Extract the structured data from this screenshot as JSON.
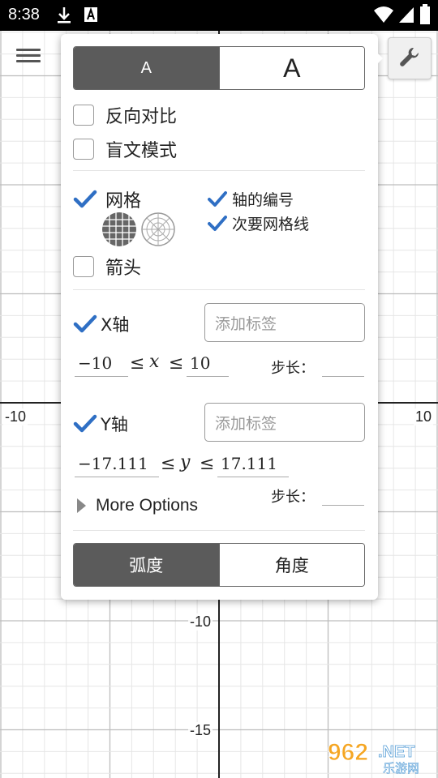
{
  "status_bar": {
    "time": "8:38",
    "icons": [
      "download-icon",
      "a-notification-icon",
      "wifi-icon",
      "signal-icon",
      "battery-icon"
    ]
  },
  "graph": {
    "axis_labels": {
      "x_neg": "-10",
      "x_pos": "10",
      "y_neg_10": "-10",
      "y_neg_15": "-15"
    }
  },
  "toolbar": {
    "menu_icon": "hamburger-menu-icon",
    "settings_icon": "wrench-icon"
  },
  "settings": {
    "font_size": {
      "small": "A",
      "large": "A",
      "selected": "small"
    },
    "reverse_contrast": {
      "label": "反向对比",
      "checked": false
    },
    "braille_mode": {
      "label": "盲文模式",
      "checked": false
    },
    "grid": {
      "label": "网格",
      "checked": true,
      "types": [
        "cartesian-grid-icon",
        "polar-grid-icon"
      ],
      "selected_type": "cartesian-grid-icon"
    },
    "axis_numbers": {
      "label": "轴的编号",
      "checked": true
    },
    "minor_gridlines": {
      "label": "次要网格线",
      "checked": true
    },
    "arrows": {
      "label": "箭头",
      "checked": false
    },
    "x_axis": {
      "label": "X轴",
      "checked": true,
      "placeholder": "添加标签",
      "min": "−10",
      "max": "10",
      "var": "x",
      "op": "≤",
      "step_label": "步长："
    },
    "y_axis": {
      "label": "Y轴",
      "checked": true,
      "placeholder": "添加标签",
      "min": "−17.111",
      "max": "17.111",
      "var": "y",
      "op": "≤",
      "step_label": "步长："
    },
    "more_options": "More Options",
    "angle_mode": {
      "radians": "弧度",
      "degrees": "角度",
      "selected": "radians"
    }
  },
  "watermark": {
    "text": "962",
    "suffix": ".NET",
    "sub": "乐游网"
  },
  "colors": {
    "check": "#2f6fc4",
    "selected_segment": "#5b5b5b",
    "axis": "#222222",
    "grid_major": "#bdbdbd",
    "grid_minor": "#e6e6e6"
  }
}
